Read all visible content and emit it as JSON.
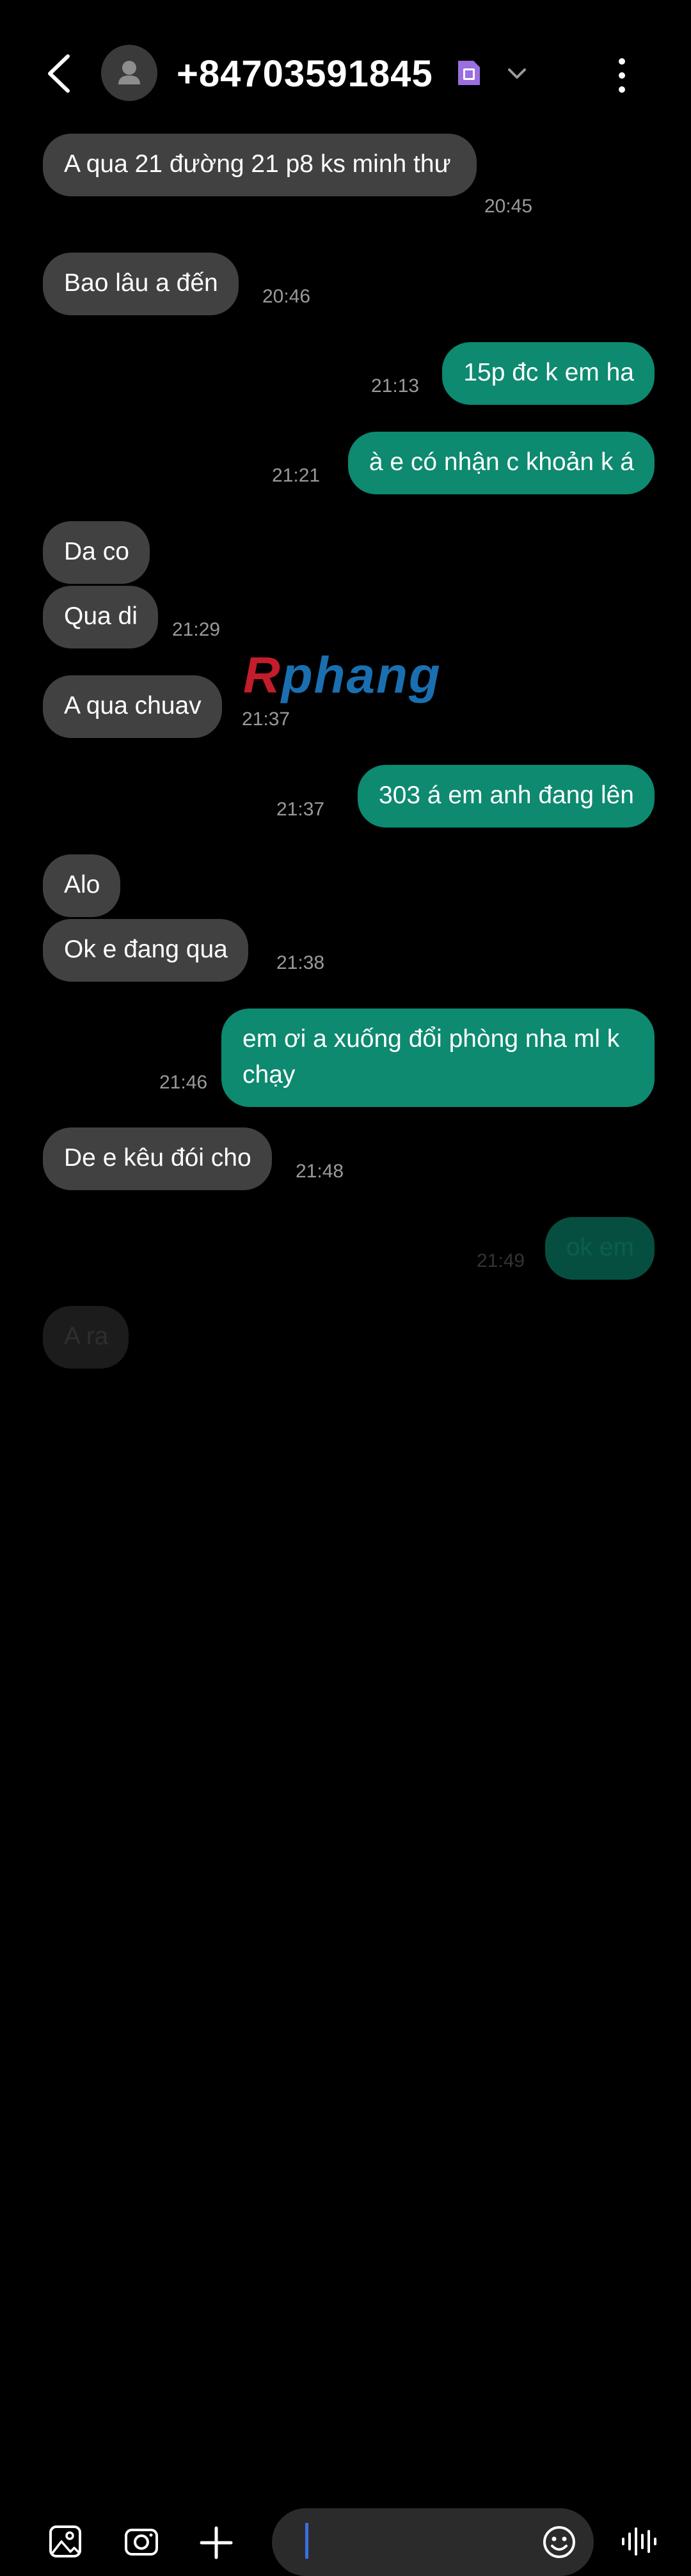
{
  "header": {
    "title": "+84703591845",
    "icons": [
      "back-arrow-icon",
      "contact-avatar-icon",
      "sim-card-icon",
      "chevron-down-icon",
      "more-options-icon"
    ]
  },
  "messages": [
    {
      "dir": "in",
      "text": "A qua 21 đường 21 p8 ks minh thư",
      "time": "20:45"
    },
    {
      "dir": "in",
      "text": "Bao lâu a đến",
      "time": "20:46"
    },
    {
      "dir": "out",
      "text": "15p đc k em ha",
      "time": "21:13"
    },
    {
      "dir": "out",
      "text": "à e có nhận c khoản k á",
      "time": "21:21"
    },
    {
      "dir": "in",
      "text": "Da co",
      "time": ""
    },
    {
      "dir": "in",
      "text": "Qua di",
      "time": "21:29"
    },
    {
      "dir": "in",
      "text": "A qua chuav",
      "time": "21:37"
    },
    {
      "dir": "out",
      "text": "303 á em anh đang lên",
      "time": "21:37"
    },
    {
      "dir": "in",
      "text": "Alo",
      "time": ""
    },
    {
      "dir": "in",
      "text": "Ok e đang qua",
      "time": "21:38"
    },
    {
      "dir": "out",
      "text": "em ơi a xuống đổi phòng nha ml k chạy",
      "time": "21:46"
    },
    {
      "dir": "in",
      "text": "De e kêu đói cho",
      "time": "21:48"
    },
    {
      "dir": "out",
      "text": "ok em",
      "time": "21:49"
    },
    {
      "dir": "in",
      "text": "A ra",
      "time": ""
    }
  ],
  "watermark": {
    "first": "R",
    "rest": "phang"
  },
  "composer": {
    "placeholder": "",
    "icons": [
      "gallery-icon",
      "camera-icon",
      "plus-icon",
      "emoji-icon",
      "voice-recorder-icon"
    ]
  },
  "colors": {
    "incoming": "#414141",
    "outgoing": "#0d8a70",
    "background": "#000000",
    "caret": "#3b6fe0"
  }
}
